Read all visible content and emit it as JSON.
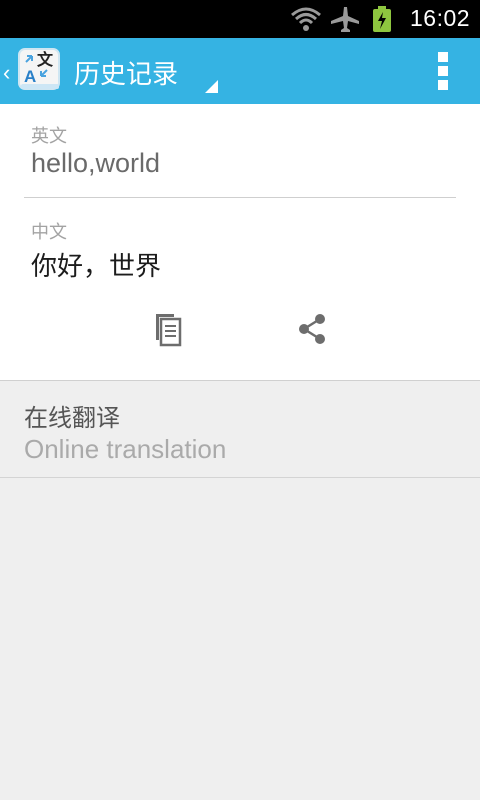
{
  "status_bar": {
    "time": "16:02",
    "icons": [
      "wifi-icon",
      "airplane-icon",
      "battery-charging-icon"
    ]
  },
  "action_bar": {
    "title": "历史记录",
    "app_icon": "translate-app-icon",
    "back_glyph": "‹",
    "colors": {
      "background": "#35b3e3",
      "text": "#ffffff"
    }
  },
  "entry": {
    "source_label": "英文",
    "source_text": "hello,world",
    "target_label": "中文",
    "target_text": "你好，世界",
    "actions": [
      "copy-icon",
      "share-icon"
    ]
  },
  "online": {
    "title": "在线翻译",
    "subtitle": "Online translation"
  }
}
